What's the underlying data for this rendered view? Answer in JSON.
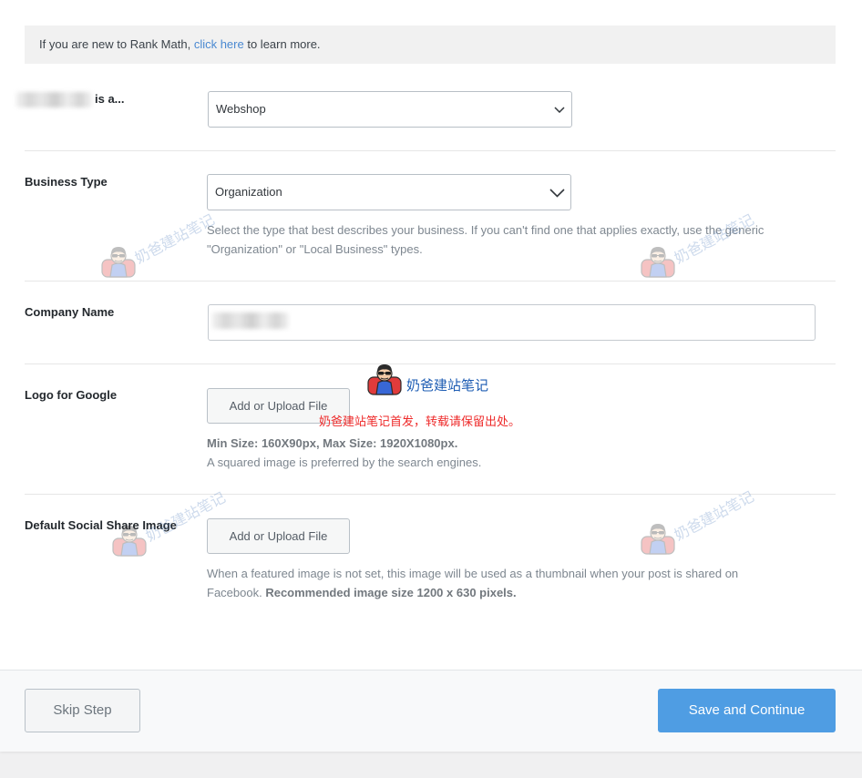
{
  "notice": {
    "prefix": "If you are new to Rank Math, ",
    "link": "click here",
    "suffix": " to learn more."
  },
  "site_type": {
    "label": "is a...",
    "value": "Webshop",
    "icon": "chevron-down-icon"
  },
  "business_type": {
    "label": "Business Type",
    "value": "Organization",
    "icon": "chevron-down-icon",
    "description_lines": [
      "Select the type that best describes your business. If you can't find one that applies exactly, use the generic",
      "\"Organization\" or \"Local Business\" types."
    ]
  },
  "company_name": {
    "label": "Company Name"
  },
  "logo": {
    "label": "Logo for Google",
    "button": "Add or Upload File",
    "size_note": "Min Size: 160X90px, Max Size: 1920X1080px.",
    "description": "A squared image is preferred by the search engines."
  },
  "social_image": {
    "label": "Default Social Share Image",
    "button": "Add or Upload File",
    "description_lines": [
      "When a featured image is not set, this image will be used as a thumbnail when your post is shared on",
      "Facebook."
    ],
    "recommendation": "Recommended image size 1200 x 630 pixels."
  },
  "footer": {
    "skip": "Skip Step",
    "save": "Save and Continue"
  },
  "watermark": {
    "brand": "奶爸建站笔记",
    "notice": "奶爸建站笔记首发，转载请保留出处。",
    "icon": "avatar-icon"
  },
  "colors": {
    "accent": "#4f9de3",
    "link": "#4a89d1",
    "watermark_brand": "#1d5cb3",
    "watermark_notice": "#ee2a2a"
  }
}
